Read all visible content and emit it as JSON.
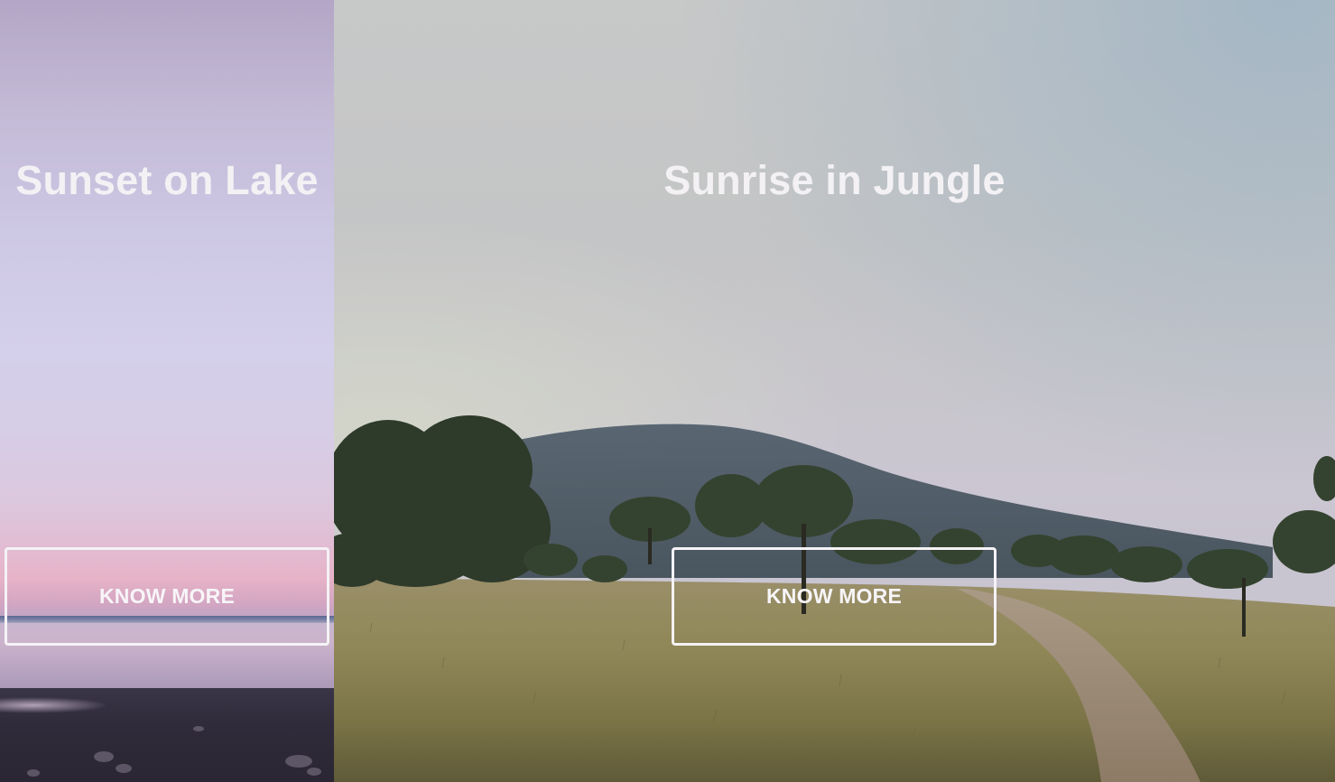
{
  "slides": [
    {
      "title": "Sunset on Lake",
      "button_label": "KNOW MORE"
    },
    {
      "title": "Sunrise in Jungle",
      "button_label": "KNOW MORE"
    }
  ]
}
